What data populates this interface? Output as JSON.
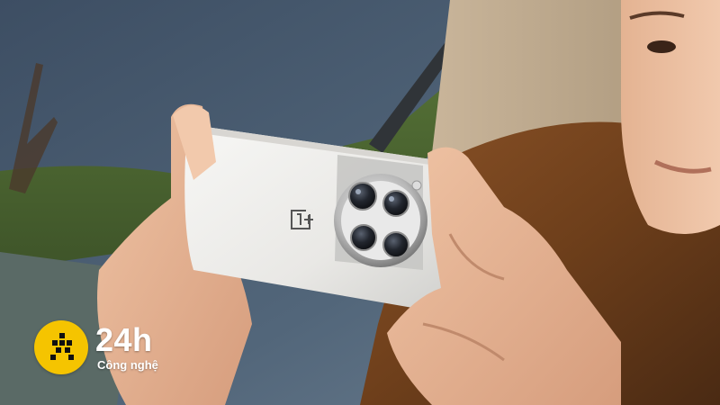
{
  "watermark": {
    "brand": "24h",
    "subtitle": "Công nghệ",
    "logo_icon": "running-man-icon",
    "badge_color": "#f5c400"
  },
  "phone": {
    "logo_icon": "oneplus-logo-icon",
    "camera_icon": "circular-camera-module-icon"
  }
}
